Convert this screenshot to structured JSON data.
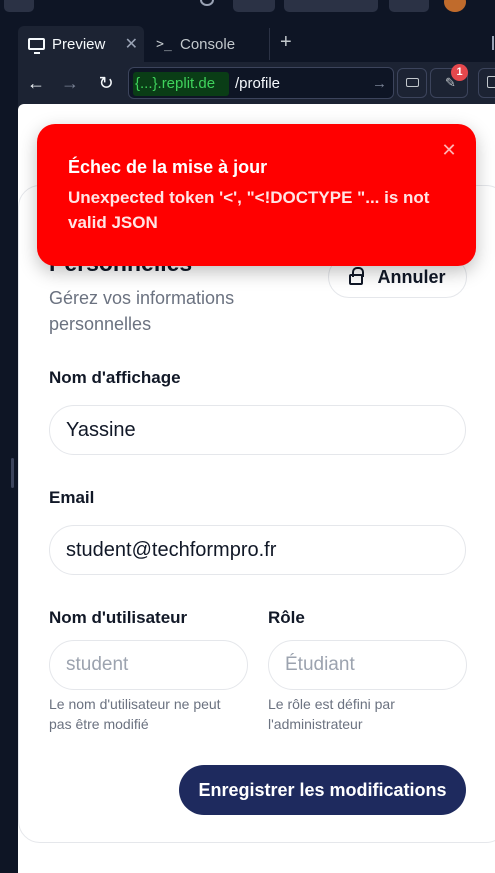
{
  "browser": {
    "tabs": [
      {
        "label": "Preview",
        "icon": "monitor-icon",
        "close": "✕"
      },
      {
        "label": "Console",
        "icon": "terminal-icon"
      }
    ],
    "add_tab": "+",
    "url": {
      "host": "{...}.replit.de",
      "path": "/profile"
    },
    "notifications_count": "1"
  },
  "toast": {
    "title": "Échec de la mise à jour",
    "message": "Unexpected token '<', \"<!DOCTYPE \"... is not valid JSON",
    "close": "✕",
    "color": "#ff0000"
  },
  "profile": {
    "title": "Personnelles",
    "subtitle": "Gérez vos informations personnelles",
    "cancel_label": "Annuler",
    "fields": {
      "display_name": {
        "label": "Nom d'affichage",
        "value": "Yassine"
      },
      "email": {
        "label": "Email",
        "value": "student@techformpro.fr"
      },
      "username": {
        "label": "Nom d'utilisateur",
        "placeholder": "student",
        "hint": "Le nom d'utilisateur ne peut pas être modifié"
      },
      "role": {
        "label": "Rôle",
        "placeholder": "Étudiant",
        "hint": "Le rôle est défini par l'administrateur"
      }
    },
    "save_label": "Enregistrer les modifications",
    "accent_color": "#1e2a5e"
  }
}
